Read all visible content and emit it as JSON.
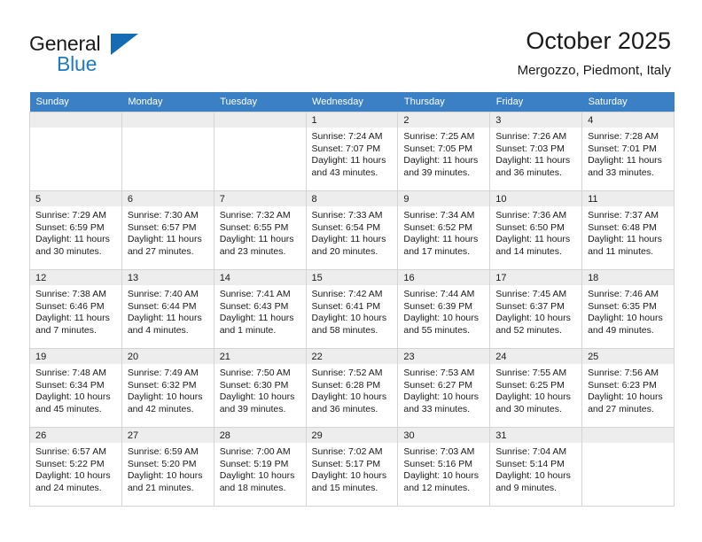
{
  "logo": {
    "word1": "General",
    "word2": "Blue",
    "triangle_color": "#156bb4"
  },
  "header": {
    "title": "October 2025",
    "subtitle": "Mergozzo, Piedmont, Italy"
  },
  "theme": {
    "header_row_bg": "#3b7fc4",
    "daynum_bg": "#ededed",
    "grid_line": "#d4d4d4",
    "text": "#1a1a1a"
  },
  "weekdays": [
    "Sunday",
    "Monday",
    "Tuesday",
    "Wednesday",
    "Thursday",
    "Friday",
    "Saturday"
  ],
  "labels": {
    "sunrise_prefix": "Sunrise:",
    "sunset_prefix": "Sunset:",
    "daylight_prefix": "Daylight:"
  },
  "weeks": [
    [
      {
        "day": "",
        "empty": true
      },
      {
        "day": "",
        "empty": true
      },
      {
        "day": "",
        "empty": true
      },
      {
        "day": "1",
        "sunrise": "Sunrise: 7:24 AM",
        "sunset": "Sunset: 7:07 PM",
        "daylight1": "Daylight: 11 hours",
        "daylight2": "and 43 minutes."
      },
      {
        "day": "2",
        "sunrise": "Sunrise: 7:25 AM",
        "sunset": "Sunset: 7:05 PM",
        "daylight1": "Daylight: 11 hours",
        "daylight2": "and 39 minutes."
      },
      {
        "day": "3",
        "sunrise": "Sunrise: 7:26 AM",
        "sunset": "Sunset: 7:03 PM",
        "daylight1": "Daylight: 11 hours",
        "daylight2": "and 36 minutes."
      },
      {
        "day": "4",
        "sunrise": "Sunrise: 7:28 AM",
        "sunset": "Sunset: 7:01 PM",
        "daylight1": "Daylight: 11 hours",
        "daylight2": "and 33 minutes."
      }
    ],
    [
      {
        "day": "5",
        "sunrise": "Sunrise: 7:29 AM",
        "sunset": "Sunset: 6:59 PM",
        "daylight1": "Daylight: 11 hours",
        "daylight2": "and 30 minutes."
      },
      {
        "day": "6",
        "sunrise": "Sunrise: 7:30 AM",
        "sunset": "Sunset: 6:57 PM",
        "daylight1": "Daylight: 11 hours",
        "daylight2": "and 27 minutes."
      },
      {
        "day": "7",
        "sunrise": "Sunrise: 7:32 AM",
        "sunset": "Sunset: 6:55 PM",
        "daylight1": "Daylight: 11 hours",
        "daylight2": "and 23 minutes."
      },
      {
        "day": "8",
        "sunrise": "Sunrise: 7:33 AM",
        "sunset": "Sunset: 6:54 PM",
        "daylight1": "Daylight: 11 hours",
        "daylight2": "and 20 minutes."
      },
      {
        "day": "9",
        "sunrise": "Sunrise: 7:34 AM",
        "sunset": "Sunset: 6:52 PM",
        "daylight1": "Daylight: 11 hours",
        "daylight2": "and 17 minutes."
      },
      {
        "day": "10",
        "sunrise": "Sunrise: 7:36 AM",
        "sunset": "Sunset: 6:50 PM",
        "daylight1": "Daylight: 11 hours",
        "daylight2": "and 14 minutes."
      },
      {
        "day": "11",
        "sunrise": "Sunrise: 7:37 AM",
        "sunset": "Sunset: 6:48 PM",
        "daylight1": "Daylight: 11 hours",
        "daylight2": "and 11 minutes."
      }
    ],
    [
      {
        "day": "12",
        "sunrise": "Sunrise: 7:38 AM",
        "sunset": "Sunset: 6:46 PM",
        "daylight1": "Daylight: 11 hours",
        "daylight2": "and 7 minutes."
      },
      {
        "day": "13",
        "sunrise": "Sunrise: 7:40 AM",
        "sunset": "Sunset: 6:44 PM",
        "daylight1": "Daylight: 11 hours",
        "daylight2": "and 4 minutes."
      },
      {
        "day": "14",
        "sunrise": "Sunrise: 7:41 AM",
        "sunset": "Sunset: 6:43 PM",
        "daylight1": "Daylight: 11 hours",
        "daylight2": "and 1 minute."
      },
      {
        "day": "15",
        "sunrise": "Sunrise: 7:42 AM",
        "sunset": "Sunset: 6:41 PM",
        "daylight1": "Daylight: 10 hours",
        "daylight2": "and 58 minutes."
      },
      {
        "day": "16",
        "sunrise": "Sunrise: 7:44 AM",
        "sunset": "Sunset: 6:39 PM",
        "daylight1": "Daylight: 10 hours",
        "daylight2": "and 55 minutes."
      },
      {
        "day": "17",
        "sunrise": "Sunrise: 7:45 AM",
        "sunset": "Sunset: 6:37 PM",
        "daylight1": "Daylight: 10 hours",
        "daylight2": "and 52 minutes."
      },
      {
        "day": "18",
        "sunrise": "Sunrise: 7:46 AM",
        "sunset": "Sunset: 6:35 PM",
        "daylight1": "Daylight: 10 hours",
        "daylight2": "and 49 minutes."
      }
    ],
    [
      {
        "day": "19",
        "sunrise": "Sunrise: 7:48 AM",
        "sunset": "Sunset: 6:34 PM",
        "daylight1": "Daylight: 10 hours",
        "daylight2": "and 45 minutes."
      },
      {
        "day": "20",
        "sunrise": "Sunrise: 7:49 AM",
        "sunset": "Sunset: 6:32 PM",
        "daylight1": "Daylight: 10 hours",
        "daylight2": "and 42 minutes."
      },
      {
        "day": "21",
        "sunrise": "Sunrise: 7:50 AM",
        "sunset": "Sunset: 6:30 PM",
        "daylight1": "Daylight: 10 hours",
        "daylight2": "and 39 minutes."
      },
      {
        "day": "22",
        "sunrise": "Sunrise: 7:52 AM",
        "sunset": "Sunset: 6:28 PM",
        "daylight1": "Daylight: 10 hours",
        "daylight2": "and 36 minutes."
      },
      {
        "day": "23",
        "sunrise": "Sunrise: 7:53 AM",
        "sunset": "Sunset: 6:27 PM",
        "daylight1": "Daylight: 10 hours",
        "daylight2": "and 33 minutes."
      },
      {
        "day": "24",
        "sunrise": "Sunrise: 7:55 AM",
        "sunset": "Sunset: 6:25 PM",
        "daylight1": "Daylight: 10 hours",
        "daylight2": "and 30 minutes."
      },
      {
        "day": "25",
        "sunrise": "Sunrise: 7:56 AM",
        "sunset": "Sunset: 6:23 PM",
        "daylight1": "Daylight: 10 hours",
        "daylight2": "and 27 minutes."
      }
    ],
    [
      {
        "day": "26",
        "sunrise": "Sunrise: 6:57 AM",
        "sunset": "Sunset: 5:22 PM",
        "daylight1": "Daylight: 10 hours",
        "daylight2": "and 24 minutes."
      },
      {
        "day": "27",
        "sunrise": "Sunrise: 6:59 AM",
        "sunset": "Sunset: 5:20 PM",
        "daylight1": "Daylight: 10 hours",
        "daylight2": "and 21 minutes."
      },
      {
        "day": "28",
        "sunrise": "Sunrise: 7:00 AM",
        "sunset": "Sunset: 5:19 PM",
        "daylight1": "Daylight: 10 hours",
        "daylight2": "and 18 minutes."
      },
      {
        "day": "29",
        "sunrise": "Sunrise: 7:02 AM",
        "sunset": "Sunset: 5:17 PM",
        "daylight1": "Daylight: 10 hours",
        "daylight2": "and 15 minutes."
      },
      {
        "day": "30",
        "sunrise": "Sunrise: 7:03 AM",
        "sunset": "Sunset: 5:16 PM",
        "daylight1": "Daylight: 10 hours",
        "daylight2": "and 12 minutes."
      },
      {
        "day": "31",
        "sunrise": "Sunrise: 7:04 AM",
        "sunset": "Sunset: 5:14 PM",
        "daylight1": "Daylight: 10 hours",
        "daylight2": "and 9 minutes."
      },
      {
        "day": "",
        "empty": true
      }
    ]
  ]
}
